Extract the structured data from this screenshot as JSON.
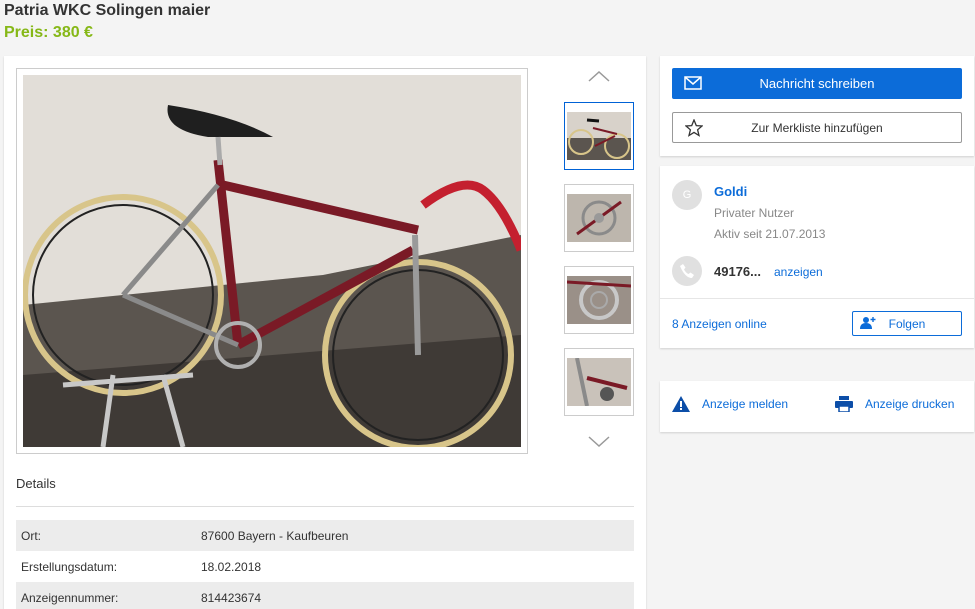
{
  "listing": {
    "title": "Patria WKC Solingen maier",
    "price": "Preis: 380 €"
  },
  "gallery": {
    "thumbnail_count": 4,
    "active_index": 0
  },
  "details": {
    "heading": "Details",
    "rows": [
      {
        "label": "Ort:",
        "value": "87600 Bayern - Kaufbeuren"
      },
      {
        "label": "Erstellungsdatum:",
        "value": "18.02.2018"
      },
      {
        "label": "Anzeigennummer:",
        "value": "814423674"
      }
    ]
  },
  "actions": {
    "message_label": "Nachricht schreiben",
    "watchlist_label": "Zur Merkliste hinzufügen"
  },
  "seller": {
    "avatar_letter": "G",
    "name": "Goldi",
    "type": "Privater Nutzer",
    "active_since": "Aktiv seit 21.07.2013",
    "phone_partial": "49176...",
    "phone_reveal_label": "anzeigen",
    "ads_online": "8 Anzeigen online",
    "follow_label": "Folgen"
  },
  "footer_actions": {
    "report_label": "Anzeige melden",
    "print_label": "Anzeige drucken"
  },
  "colors": {
    "accent": "#0c6cd9",
    "price": "#86b817"
  }
}
